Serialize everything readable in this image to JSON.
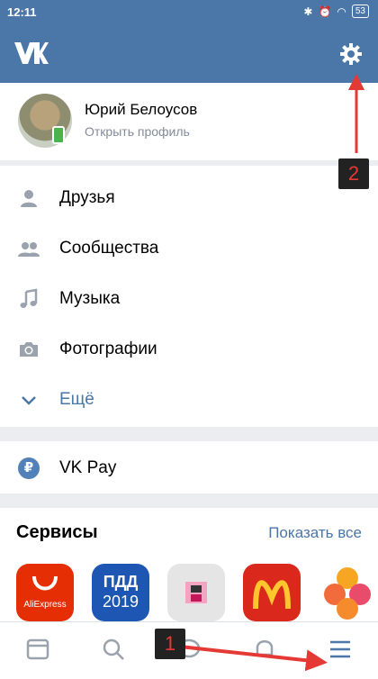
{
  "status": {
    "time": "12:11",
    "battery": "53"
  },
  "header": {
    "logo": "VK",
    "settings_icon": "gear-icon"
  },
  "profile": {
    "name": "Юрий Белоусов",
    "subtitle": "Открыть профиль"
  },
  "menu": {
    "items": [
      {
        "label": "Друзья",
        "icon": "person-icon"
      },
      {
        "label": "Сообщества",
        "icon": "people-icon"
      },
      {
        "label": "Музыка",
        "icon": "music-icon"
      },
      {
        "label": "Фотографии",
        "icon": "camera-icon"
      },
      {
        "label": "Ещё",
        "icon": "chevron-down-icon"
      }
    ]
  },
  "pay": {
    "label": "VK Pay",
    "icon_glyph": "₽"
  },
  "services": {
    "title": "Сервисы",
    "show_all": "Показать все",
    "apps": [
      {
        "name": "AliExpress",
        "text": "AliExpress"
      },
      {
        "name": "ПДД 2019",
        "line1": "ПДД",
        "line2": "2019"
      },
      {
        "name": "game"
      },
      {
        "name": "McDonald's"
      },
      {
        "name": "flower app"
      }
    ]
  },
  "tabbar": {
    "items": [
      "news-icon",
      "search-icon",
      "messages-icon",
      "notifications-icon",
      "menu-icon"
    ]
  },
  "annotations": {
    "marker1": "1",
    "marker2": "2"
  },
  "colors": {
    "brand": "#4a76a8",
    "annotation": "#e53935"
  }
}
